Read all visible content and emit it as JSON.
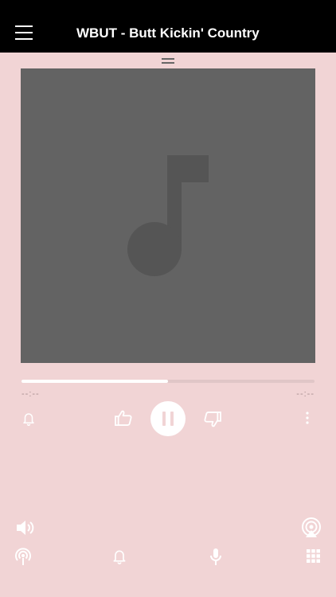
{
  "header": {
    "title": "WBUT - Butt Kickin' Country",
    "menu_icon": "hamburger-menu-icon"
  },
  "player": {
    "artwork_icon": "music-note-icon",
    "progress_percent": 50,
    "elapsed": "--:--",
    "remaining": "--:--",
    "controls": {
      "alarm_icon": "bell-icon",
      "like_icon": "thumbs-up-icon",
      "play_pause_icon": "pause-icon",
      "dislike_icon": "thumbs-down-icon",
      "more_icon": "more-vertical-icon"
    }
  },
  "bottom_bar": {
    "volume_icon": "volume-icon",
    "airplay_icon": "airplay-icon",
    "podcast_icon": "podcast-icon",
    "alarm_icon": "bell-icon",
    "mic_icon": "microphone-icon",
    "grid_icon": "grid-icon"
  },
  "colors": {
    "background": "#f1d4d5",
    "header": "#000000",
    "artwork": "#636363",
    "icon": "#ffffff"
  }
}
